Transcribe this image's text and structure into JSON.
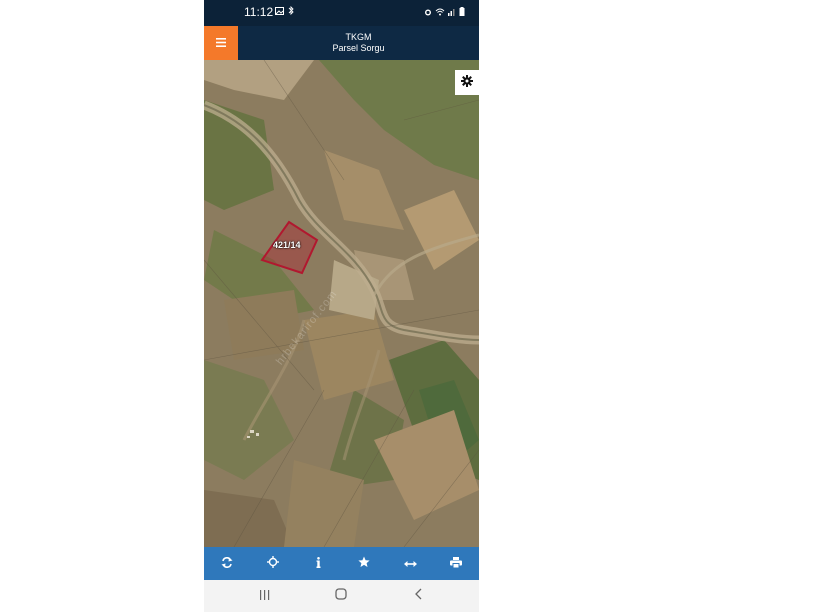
{
  "status_bar": {
    "time": "11:12",
    "left_icons": [
      "image-icon",
      "bluetooth-icon"
    ],
    "right_icons": [
      "alarm-icon",
      "wifi-icon",
      "signal-icon",
      "battery-icon"
    ]
  },
  "app_bar": {
    "menu_icon": "hamburger-menu-icon",
    "title": "TKGM",
    "subtitle": "Parsel Sorgu",
    "menu_color": "#f4792a",
    "bar_color": "#0e2944"
  },
  "map": {
    "parcel_label": "421/14",
    "parcel_color": "#b1182f",
    "watermark": "hrbekarirof.com",
    "settings_icon": "gear-icon"
  },
  "toolbar": {
    "color": "#2f78bb",
    "buttons": [
      {
        "icon": "refresh-icon"
      },
      {
        "icon": "locate-crosshair-icon"
      },
      {
        "icon": "info-icon"
      },
      {
        "icon": "star-icon"
      },
      {
        "icon": "measure-arrows-icon"
      },
      {
        "icon": "print-icon"
      }
    ]
  },
  "nav_bar": {
    "buttons": [
      "recent-apps-icon",
      "home-icon",
      "back-icon"
    ]
  }
}
